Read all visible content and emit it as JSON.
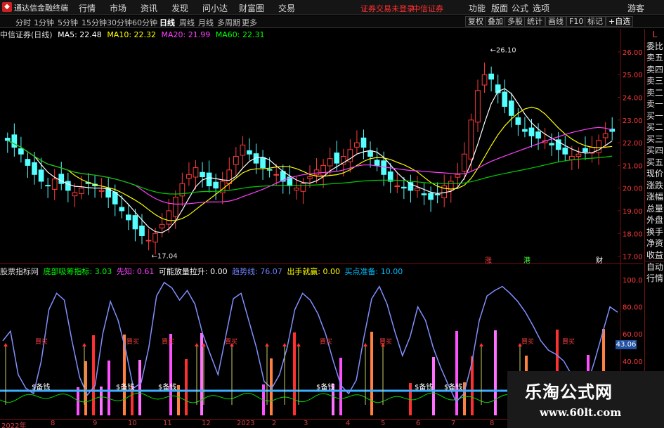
{
  "app": {
    "title": "通达信金融终端",
    "menu": [
      "行情",
      "市场",
      "资讯",
      "发现",
      "问小达",
      "财富圈",
      "交易"
    ],
    "notice": [
      "证券交易未登录",
      "中信证券"
    ],
    "right_menu": [
      "功能",
      "版面",
      "公式",
      "选项",
      "游客"
    ],
    "icon": "tdx-logo-icon"
  },
  "periods": [
    "分时",
    "1分钟",
    "5分钟",
    "15分钟",
    "30分钟",
    "60分钟",
    "日线",
    "周线",
    "月线",
    "多周期",
    "更多"
  ],
  "active_period": "日线",
  "tools": [
    "复权",
    "叠加",
    "多股",
    "统计",
    "画线",
    "F10",
    "标记",
    "+自选"
  ],
  "main_chart": {
    "stock": "中信证券(日线)",
    "ma": [
      {
        "label": "MA5: 22.48",
        "color": "#ffffff"
      },
      {
        "label": "MA10: 22.32",
        "color": "#ffff00"
      },
      {
        "label": "MA20: 21.99",
        "color": "#ff40ff"
      },
      {
        "label": "MA60: 22.31",
        "color": "#00ff00"
      }
    ],
    "high_label": "26.10",
    "low_label": "17.04",
    "events": [
      "涨",
      "港",
      "财"
    ]
  },
  "indicator": {
    "name": "股票指标网",
    "items": [
      {
        "label": "底部吸筹指标: 3.03",
        "color": "#00ff00"
      },
      {
        "label": "先知: 0.61",
        "color": "#ff40ff"
      },
      {
        "label": "可能放量拉升: 0.00",
        "color": "#ffffff"
      },
      {
        "label": "趋势线: 76.07",
        "color": "#7080ff"
      },
      {
        "label": "出手就赢: 0.00",
        "color": "#ffff00"
      },
      {
        "label": "买点准备: 10.00",
        "color": "#00bfff"
      }
    ],
    "current": "43.06",
    "buy_label": "買买",
    "money_label": "$备钱"
  },
  "chart_data": [
    {
      "type": "line",
      "title": "中信证券(日线)",
      "ylim": [
        16.8,
        26.4
      ],
      "yticks": [
        "26.00",
        "25.00",
        "24.00",
        "23.00",
        "22.00",
        "21.00",
        "20.00",
        "19.00",
        "18.00",
        "17.00"
      ],
      "xticks": [
        "2022年",
        "8",
        "9",
        "10",
        "11",
        "12",
        "2023",
        "2",
        "3",
        "4",
        "5",
        "6",
        "7",
        "8"
      ],
      "close": [
        22.1,
        21.8,
        21.5,
        21.0,
        20.6,
        20.3,
        20.1,
        20.4,
        20.2,
        19.9,
        19.8,
        20.0,
        20.2,
        20.1,
        19.9,
        19.6,
        19.3,
        19.0,
        18.6,
        18.2,
        17.9,
        17.7,
        18.0,
        18.4,
        19.0,
        19.6,
        20.2,
        20.6,
        20.9,
        20.5,
        20.1,
        20.0,
        20.3,
        20.8,
        21.4,
        21.9,
        21.5,
        21.1,
        20.9,
        20.8,
        20.6,
        20.3,
        20.1,
        20.0,
        20.2,
        20.5,
        20.8,
        21.0,
        21.3,
        21.1,
        21.4,
        21.7,
        22.0,
        21.8,
        21.4,
        21.0,
        20.6,
        20.3,
        20.1,
        20.0,
        19.9,
        20.0,
        19.7,
        19.5,
        19.7,
        20.1,
        20.3,
        20.6,
        21.5,
        23.0,
        24.3,
        25.0,
        24.8,
        24.2,
        23.6,
        23.2,
        22.8,
        22.5,
        22.3,
        22.2,
        22.1,
        21.9,
        21.7,
        21.5,
        21.4,
        21.5,
        21.6,
        21.8,
        22.1,
        22.4,
        22.5
      ],
      "ma": [
        {
          "name": "MA5",
          "color": "#ffffff"
        },
        {
          "name": "MA10",
          "color": "#ffff00"
        },
        {
          "name": "MA20",
          "color": "#ff40ff"
        },
        {
          "name": "MA60",
          "color": "#00cc00"
        }
      ],
      "high": 26.1,
      "low": 17.04
    },
    {
      "type": "line",
      "title": "股票指标网",
      "ylim": [
        0,
        100
      ],
      "yticks": [
        "100.00",
        "80.00",
        "60.00",
        "40.00"
      ],
      "trend": [
        55,
        62,
        30,
        20,
        16,
        40,
        78,
        90,
        85,
        55,
        28,
        15,
        22,
        60,
        84,
        70,
        48,
        20,
        24,
        50,
        88,
        98,
        94,
        85,
        92,
        82,
        60,
        45,
        30,
        58,
        86,
        90,
        70,
        50,
        25,
        20,
        30,
        50,
        78,
        90,
        85,
        75,
        60,
        40,
        22,
        16,
        26,
        58,
        86,
        95,
        82,
        62,
        44,
        58,
        80,
        70,
        50,
        35,
        22,
        10,
        16,
        38,
        70,
        88,
        92,
        95,
        90,
        84,
        76,
        66,
        55,
        48,
        45,
        40,
        30,
        20,
        22,
        40,
        60,
        80,
        76
      ],
      "current": 43.06
    }
  ]
}
